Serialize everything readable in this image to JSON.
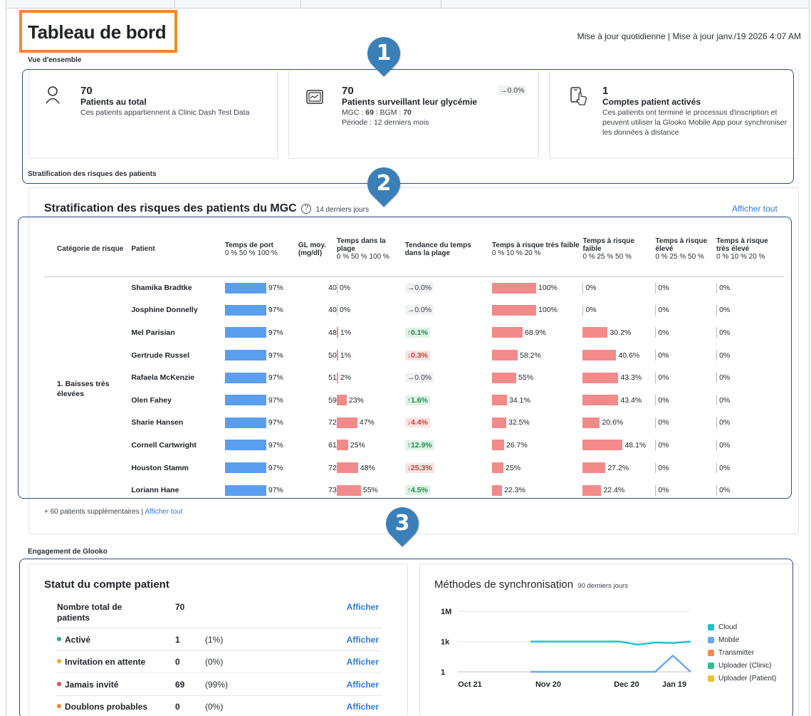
{
  "header": {
    "title": "Tableau de bord",
    "update_text": "Mise à jour quotidienne | Mise à jour  janv./19 2026 4:07 AM"
  },
  "overview": {
    "section_label": "Vue d'ensemble",
    "cards": [
      {
        "icon": "person-icon",
        "number": "70",
        "title": "Patients au total",
        "desc": "Ces patients appartiennent à Clinic Dash Test Data"
      },
      {
        "icon": "glucose-monitor-icon",
        "number": "70",
        "title": "Patients surveillant leur glycémie",
        "trend": "→0.0%",
        "mgc_label": "MGC :",
        "mgc_value": "69",
        "bgm_label": "BGM :",
        "bgm_value": "70",
        "period": "Période : 12 derniers mois"
      },
      {
        "icon": "phone-touch-icon",
        "number": "1",
        "title": "Comptes patient activés",
        "desc": "Ces patients ont terminé le processus d'inscription et peuvent utiliser la Glooko Mobile App pour synchroniser les données à distance"
      }
    ]
  },
  "risk": {
    "section_label": "Stratification des risques des patients",
    "title": "Stratification des risques des patients du MGC",
    "help": "?",
    "period": "14 derniers jours",
    "show_all": "Afficher tout",
    "columns": [
      {
        "label": "Catégorie de risque",
        "sub": ""
      },
      {
        "label": "Patient",
        "sub": ""
      },
      {
        "label": "Temps de port",
        "sub": "0 % 50 % 100 %"
      },
      {
        "label": "GL moy. (mg/dl)",
        "sub": ""
      },
      {
        "label": "Temps dans la plage",
        "sub": "0 % 50 % 100 %"
      },
      {
        "label": "Tendance du temps dans la plage",
        "sub": ""
      },
      {
        "label": "Temps à risque très faible",
        "sub": "0 % 10 % 20 %"
      },
      {
        "label": "Temps à risque faible",
        "sub": "0 % 25 % 50 %"
      },
      {
        "label": "Temps à risque élevé",
        "sub": "0 % 25 % 50 %"
      },
      {
        "label": "Temps à risque très élevé",
        "sub": "0 % 10 % 20 %"
      }
    ],
    "category": "1. Baisses très élevées",
    "rows": [
      {
        "name": "Shamika Bradtke",
        "wear": 97,
        "wear_label": "97%",
        "gl": "40",
        "tir": 0,
        "tir_label": "0%",
        "trend": "→0.0%",
        "trend_dir": "neutral",
        "vlow": 100,
        "vlow_label": "100%",
        "low": 0,
        "low_label": "0%",
        "high": 0,
        "high_label": "0%",
        "vhigh": 0,
        "vhigh_label": "0%"
      },
      {
        "name": "Josphine Donnelly",
        "wear": 97,
        "wear_label": "97%",
        "gl": "40",
        "tir": 0,
        "tir_label": "0%",
        "trend": "→0.0%",
        "trend_dir": "neutral",
        "vlow": 100,
        "vlow_label": "100%",
        "low": 0,
        "low_label": "0%",
        "high": 0,
        "high_label": "0%",
        "vhigh": 0,
        "vhigh_label": "0%"
      },
      {
        "name": "Mel Parisian",
        "wear": 97,
        "wear_label": "97%",
        "gl": "48",
        "tir": 1,
        "tir_label": "1%",
        "trend": "↑0.1%",
        "trend_dir": "up",
        "vlow": 68.9,
        "vlow_label": "68.9%",
        "low": 30.2,
        "low_label": "30.2%",
        "high": 0,
        "high_label": "0%",
        "vhigh": 0,
        "vhigh_label": "0%"
      },
      {
        "name": "Gertrude Russel",
        "wear": 97,
        "wear_label": "97%",
        "gl": "50",
        "tir": 1,
        "tir_label": "1%",
        "trend": "↓0.3%",
        "trend_dir": "down",
        "vlow": 58.2,
        "vlow_label": "58.2%",
        "low": 40.6,
        "low_label": "40.6%",
        "high": 0,
        "high_label": "0%",
        "vhigh": 0,
        "vhigh_label": "0%"
      },
      {
        "name": "Rafaela McKenzie",
        "wear": 97,
        "wear_label": "97%",
        "gl": "51",
        "tir": 2,
        "tir_label": "2%",
        "trend": "→0.0%",
        "trend_dir": "neutral",
        "vlow": 55,
        "vlow_label": "55%",
        "low": 43.3,
        "low_label": "43.3%",
        "high": 0,
        "high_label": "0%",
        "vhigh": 0,
        "vhigh_label": "0%"
      },
      {
        "name": "Olen Fahey",
        "wear": 97,
        "wear_label": "97%",
        "gl": "59",
        "tir": 23,
        "tir_label": "23%",
        "trend": "↑1.6%",
        "trend_dir": "up",
        "vlow": 34.1,
        "vlow_label": "34.1%",
        "low": 43.4,
        "low_label": "43.4%",
        "high": 0,
        "high_label": "0%",
        "vhigh": 0,
        "vhigh_label": "0%"
      },
      {
        "name": "Sharie Hansen",
        "wear": 97,
        "wear_label": "97%",
        "gl": "72",
        "tir": 47,
        "tir_label": "47%",
        "trend": "↓4.4%",
        "trend_dir": "down",
        "vlow": 32.5,
        "vlow_label": "32.5%",
        "low": 20.6,
        "low_label": "20.6%",
        "high": 0,
        "high_label": "0%",
        "vhigh": 0,
        "vhigh_label": "0%"
      },
      {
        "name": "Cornell Cartwright",
        "wear": 97,
        "wear_label": "97%",
        "gl": "61",
        "tir": 25,
        "tir_label": "25%",
        "trend": "↑12.9%",
        "trend_dir": "up",
        "vlow": 26.7,
        "vlow_label": "26.7%",
        "low": 48.1,
        "low_label": "48.1%",
        "high": 0,
        "high_label": "0%",
        "vhigh": 0,
        "vhigh_label": "0%"
      },
      {
        "name": "Houston Stamm",
        "wear": 97,
        "wear_label": "97%",
        "gl": "72",
        "tir": 48,
        "tir_label": "48%",
        "trend": "↓25.3%",
        "trend_dir": "down",
        "vlow": 25,
        "vlow_label": "25%",
        "low": 27.2,
        "low_label": "27.2%",
        "high": 0,
        "high_label": "0%",
        "vhigh": 0,
        "vhigh_label": "0%"
      },
      {
        "name": "Loriann Hane",
        "wear": 97,
        "wear_label": "97%",
        "gl": "73",
        "tir": 55,
        "tir_label": "55%",
        "trend": "↑4.5%",
        "trend_dir": "up",
        "vlow": 22.3,
        "vlow_label": "22.3%",
        "low": 22.4,
        "low_label": "22.4%",
        "high": 0,
        "high_label": "0%",
        "vhigh": 0,
        "vhigh_label": "0%"
      }
    ],
    "more_text": "+ 60 patients supplémentaires | ",
    "more_link": "Afficher tout"
  },
  "engagement": {
    "section_label": "Engagement de Glooko",
    "account": {
      "title": "Statut du compte patient",
      "rows": [
        {
          "label": "Nombre total de patients",
          "value": "70",
          "pct": "",
          "action": "Afficher",
          "dot": ""
        },
        {
          "label": "Activé",
          "value": "1",
          "pct": "(1%)",
          "action": "Afficher",
          "dot": "#22b36b"
        },
        {
          "label": "Invitation en attente",
          "value": "0",
          "pct": "(0%)",
          "action": "Afficher",
          "dot": "#f0a52c"
        },
        {
          "label": "Jamais invité",
          "value": "69",
          "pct": "(99%)",
          "action": "Afficher",
          "dot": "#e04f4f"
        },
        {
          "label": "Doublons probables",
          "value": "0",
          "pct": "(0%)",
          "action": "Afficher",
          "dot": "#f28a2c"
        }
      ]
    },
    "sync": {
      "title": "Méthodes de synchronisation",
      "period": "90 derniers jours"
    }
  },
  "annotations": [
    "1",
    "2",
    "3"
  ],
  "chart_data": {
    "type": "line",
    "title": "Méthodes de synchronisation",
    "y_scale": "log",
    "y_ticks": [
      "1M",
      "1k",
      "1"
    ],
    "x_ticks": [
      "Oct 21",
      "Nov 20",
      "Dec 20",
      "Jan 19"
    ],
    "x": [
      "Nov 20",
      "Nov 27",
      "Dec 4",
      "Dec 11",
      "Dec 18",
      "Dec 25",
      "Jan 1",
      "Jan 8",
      "Jan 15",
      "Jan 19"
    ],
    "series": [
      {
        "name": "Cloud",
        "color": "#1cc3d0",
        "values": [
          1000,
          1000,
          1000,
          1000,
          1000,
          1000,
          500,
          800,
          700,
          1000
        ]
      },
      {
        "name": "Mobile",
        "color": "#6aa8f0",
        "values": [
          1,
          1,
          1,
          1,
          1,
          1,
          1,
          1,
          40,
          1
        ]
      },
      {
        "name": "Transmitter",
        "color": "#f68b4d",
        "values": []
      },
      {
        "name": "Uploader (Clinic)",
        "color": "#2bc08f",
        "values": []
      },
      {
        "name": "Uploader (Patient)",
        "color": "#f2c12e",
        "values": []
      }
    ],
    "grid": true,
    "legend": "right"
  }
}
